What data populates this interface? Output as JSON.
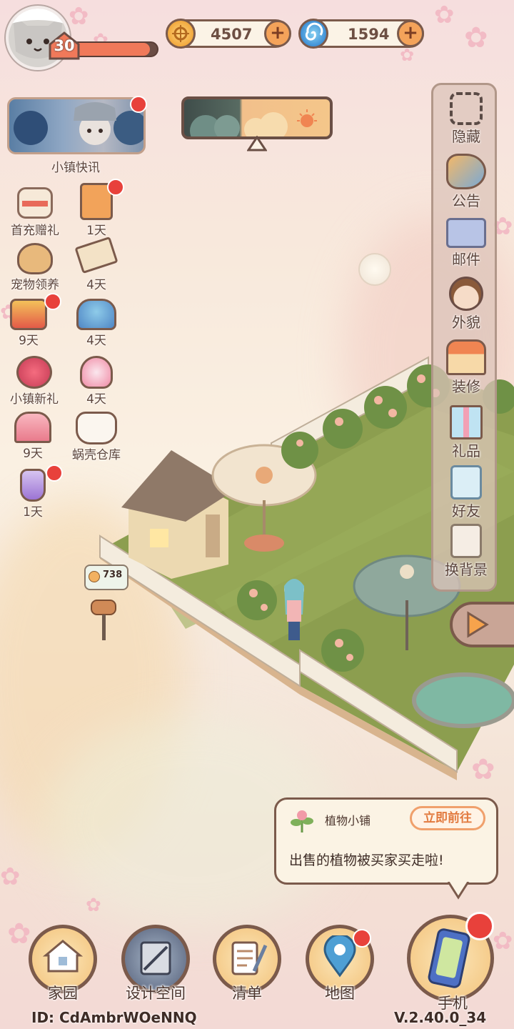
{
  "player": {
    "level": "30",
    "xp_fraction": 0.92
  },
  "currency": {
    "coins": {
      "value": "4507",
      "icon": "coin-icon"
    },
    "shells": {
      "value": "1594",
      "icon": "spiral-shell-icon"
    }
  },
  "news": {
    "label": "小镇快讯"
  },
  "events": [
    {
      "label": "首充赠礼",
      "icon": "gift-letter-icon"
    },
    {
      "label": "1天",
      "icon": "milk-carton-cat-icon"
    },
    {
      "label": "宠物领养",
      "icon": "dog-face-icon"
    },
    {
      "label": "4天",
      "icon": "letter-quill-icon"
    },
    {
      "label": "9天",
      "icon": "bugle-horn-icon"
    },
    {
      "label": "4天",
      "icon": "flower-cake-icon"
    },
    {
      "label": "小镇新礼",
      "icon": "rose-badge-icon"
    },
    {
      "label": "4天",
      "icon": "flower-fairy-icon"
    },
    {
      "label": "9天",
      "icon": "pink-bow-icon"
    },
    {
      "label": "蜗壳仓库",
      "icon": "cat-warehouse-icon"
    },
    {
      "label": "1天",
      "icon": "potion-bottle-icon"
    }
  ],
  "side_menu": [
    {
      "label": "隐藏",
      "icon": "hide-frame-icon"
    },
    {
      "label": "公告",
      "icon": "megaphone-icon"
    },
    {
      "label": "邮件",
      "icon": "mail-icon"
    },
    {
      "label": "外貌",
      "icon": "face-icon"
    },
    {
      "label": "装修",
      "icon": "house-wrench-icon"
    },
    {
      "label": "礼品",
      "icon": "gift-box-icon"
    },
    {
      "label": "好友",
      "icon": "friend-book-icon"
    },
    {
      "label": "换背景",
      "icon": "background-change-icon"
    }
  ],
  "mailbox": {
    "count": "738"
  },
  "notice": {
    "title": "植物小铺",
    "button": "立即前往",
    "message": "出售的植物被买家买走啦!"
  },
  "bottom_nav": [
    {
      "label": "家园",
      "icon": "home-icon"
    },
    {
      "label": "设计空间",
      "icon": "design-ruler-icon"
    },
    {
      "label": "清单",
      "icon": "list-quill-icon"
    },
    {
      "label": "地图",
      "icon": "map-pin-icon"
    },
    {
      "label": "手机",
      "icon": "phone-icon"
    }
  ],
  "footer": {
    "id_text": "ID: CdAmbrWOeNNQ",
    "version": "V.2.40.0_34"
  },
  "colors": {
    "accent": "#f4a35a",
    "border": "#7b5a4b",
    "badge": "#e8413b",
    "lawn": "#8c9e4f"
  }
}
